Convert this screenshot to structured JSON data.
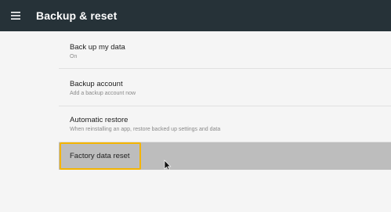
{
  "appbar": {
    "menu_icon": "hamburger-menu-icon",
    "title": "Backup & reset",
    "background": "#263238"
  },
  "items": [
    {
      "title": "Back up my data",
      "subtitle": "On"
    },
    {
      "title": "Backup account",
      "subtitle": "Add a backup account now"
    },
    {
      "title": "Automatic restore",
      "subtitle": "When reinstalling an app, restore backed up settings and data"
    },
    {
      "title": "Factory data reset",
      "subtitle": "",
      "focused": true
    }
  ],
  "colors": {
    "focus_border": "#f4b400",
    "selected_row": "#bdbdbd"
  },
  "pointer_icon": "mouse-cursor-icon"
}
